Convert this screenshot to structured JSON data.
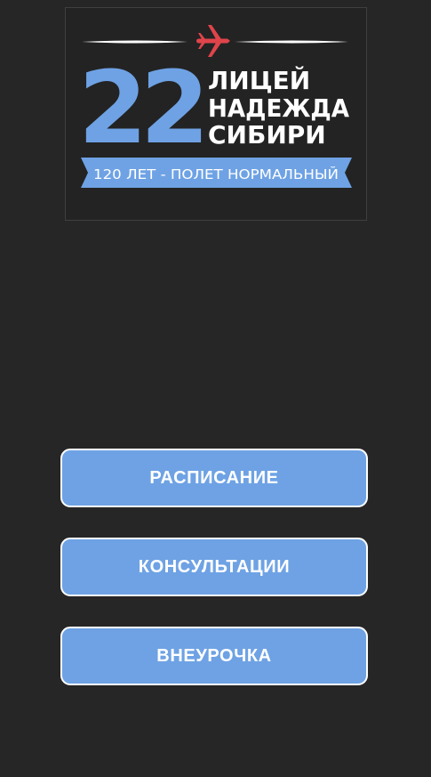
{
  "logo": {
    "number": "22",
    "line1": "ЛИЦЕЙ",
    "line2": "НАДЕЖДА",
    "line3": "СИБИРИ",
    "banner": "120 ЛЕТ - ПОЛЕТ НОРМАЛЬНЫЙ",
    "colors": {
      "accent_blue": "#6ea2e4",
      "plane_red": "#e0444b",
      "text_white": "#ffffff"
    }
  },
  "menu": {
    "schedule_label": "РАСПИСАНИЕ",
    "consultations_label": "КОНСУЛЬТАЦИИ",
    "extracurricular_label": "ВНЕУРОЧКА"
  },
  "colors": {
    "background": "#262626",
    "button": "#6ea2e4",
    "button_border": "#ffffff"
  }
}
